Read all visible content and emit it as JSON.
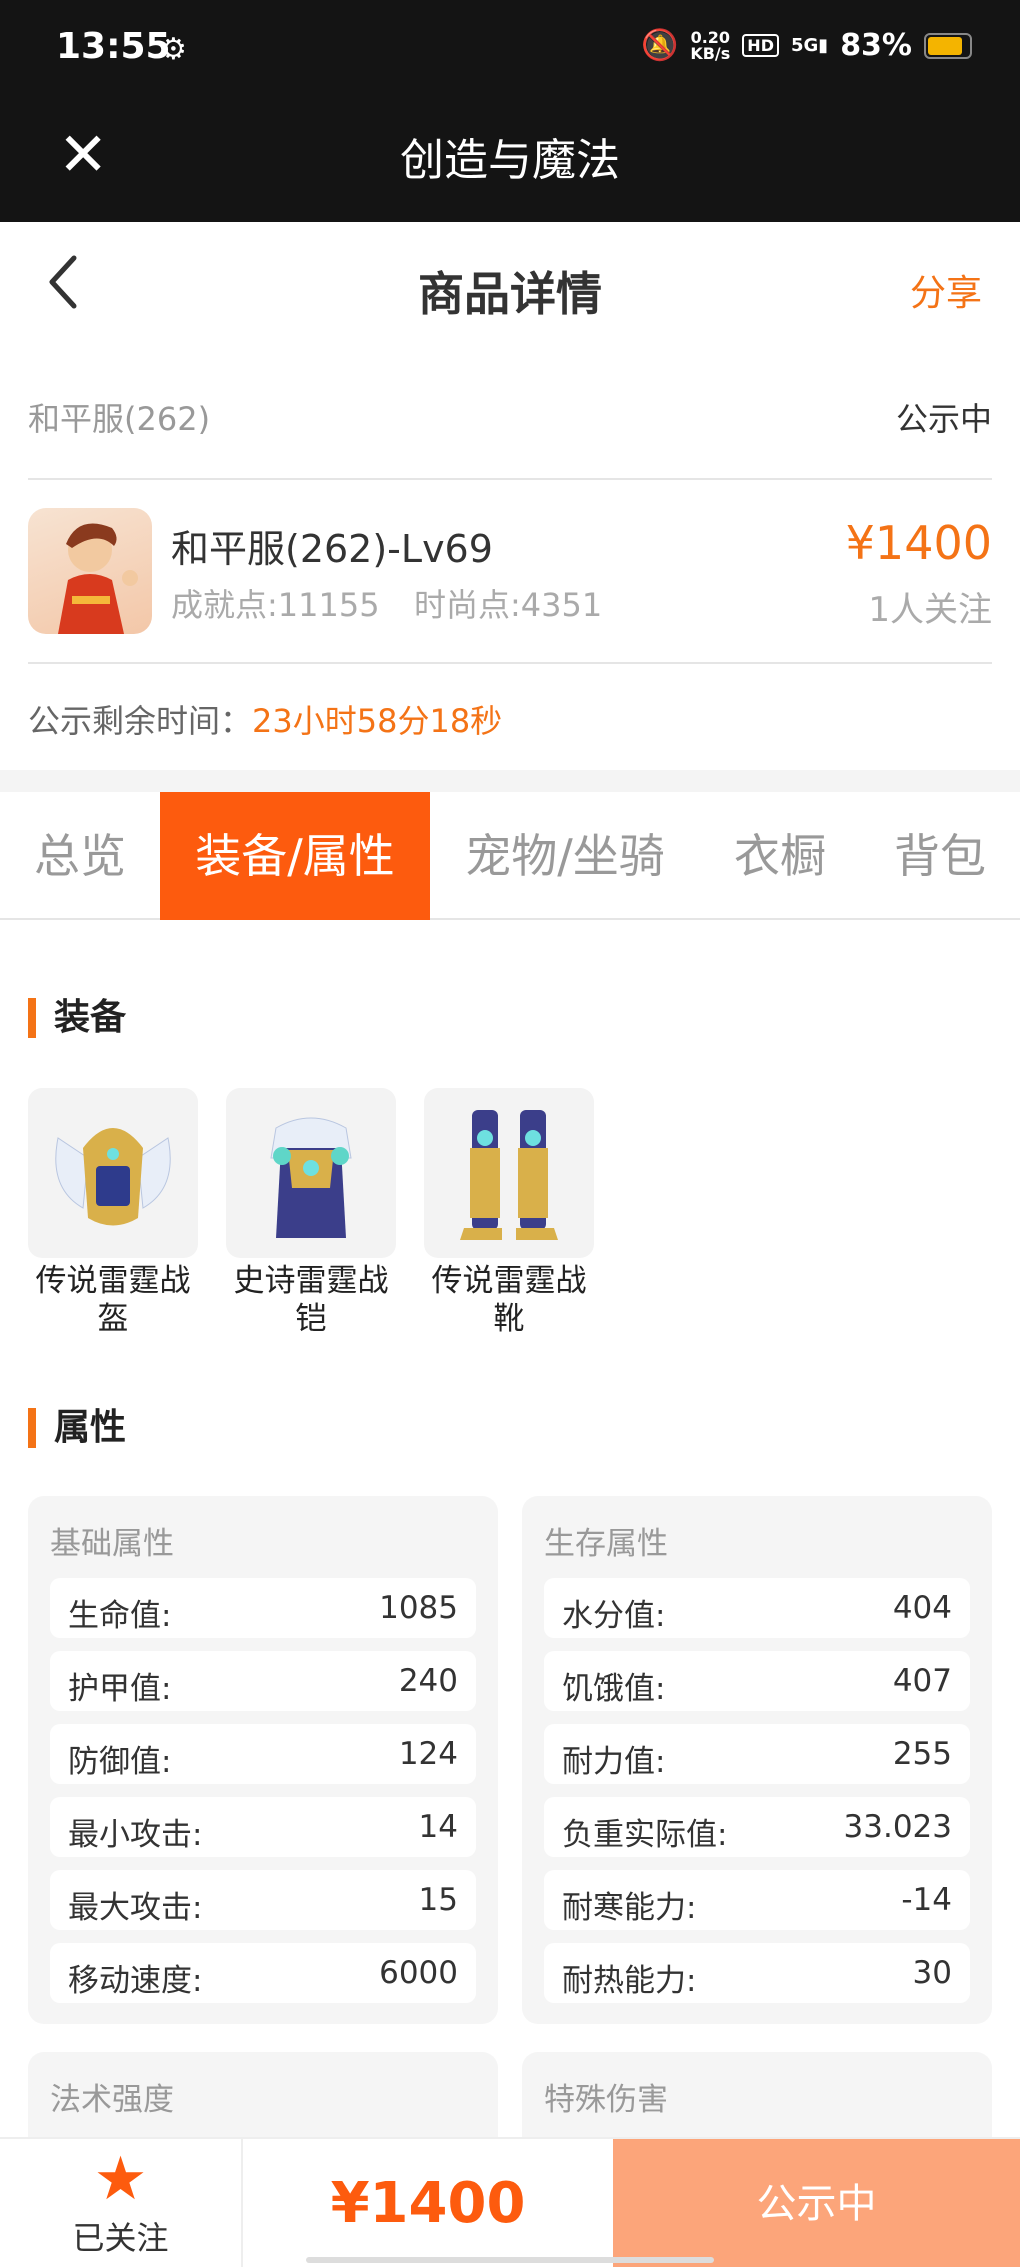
{
  "status_bar": {
    "time": "13:55",
    "speed_value": "0.20",
    "speed_unit": "KB/s",
    "hd": "HD",
    "signal": "5G",
    "battery": "83%"
  },
  "webview": {
    "title": "创造与魔法"
  },
  "nav": {
    "title": "商品详情",
    "share": "分享"
  },
  "server": {
    "name": "和平服(262)",
    "status": "公示中"
  },
  "product": {
    "name": "和平服(262)-Lv69",
    "achievement": "成就点:11155",
    "fashion": "时尚点:4351",
    "price": "¥1400",
    "followers": "1人关注"
  },
  "remaining": {
    "label": "公示剩余时间：",
    "value": "23小时58分18秒"
  },
  "tabs": [
    {
      "label": "总览",
      "active": false
    },
    {
      "label": "装备/属性",
      "active": true
    },
    {
      "label": "宠物/坐骑",
      "active": false
    },
    {
      "label": "衣橱",
      "active": false
    },
    {
      "label": "背包",
      "active": false
    }
  ],
  "equipment": {
    "title": "装备",
    "items": [
      {
        "label": "传说雷霆战盔"
      },
      {
        "label": "史诗雷霆战铠"
      },
      {
        "label": "传说雷霆战靴"
      }
    ]
  },
  "attributes": {
    "title": "属性",
    "basic": {
      "title": "基础属性",
      "rows": [
        {
          "k": "生命值:",
          "v": "1085"
        },
        {
          "k": "护甲值:",
          "v": "240"
        },
        {
          "k": "防御值:",
          "v": "124"
        },
        {
          "k": "最小攻击:",
          "v": "14"
        },
        {
          "k": "最大攻击:",
          "v": "15"
        },
        {
          "k": "移动速度:",
          "v": "6000"
        }
      ]
    },
    "survival": {
      "title": "生存属性",
      "rows": [
        {
          "k": "水分值:",
          "v": "404"
        },
        {
          "k": "饥饿值:",
          "v": "407"
        },
        {
          "k": "耐力值:",
          "v": "255"
        },
        {
          "k": "负重实际值:",
          "v": "33.023"
        },
        {
          "k": "耐寒能力:",
          "v": "-14"
        },
        {
          "k": "耐热能力:",
          "v": "30"
        }
      ]
    },
    "magic": {
      "title": "法术强度"
    },
    "special": {
      "title": "特殊伤害"
    }
  },
  "bottom": {
    "followed": "已关注",
    "price": "¥1400",
    "action": "公示中"
  },
  "colors": {
    "accent": "#f47316",
    "tab_active": "#fd5b0e",
    "action_bg": "#fca57a"
  }
}
